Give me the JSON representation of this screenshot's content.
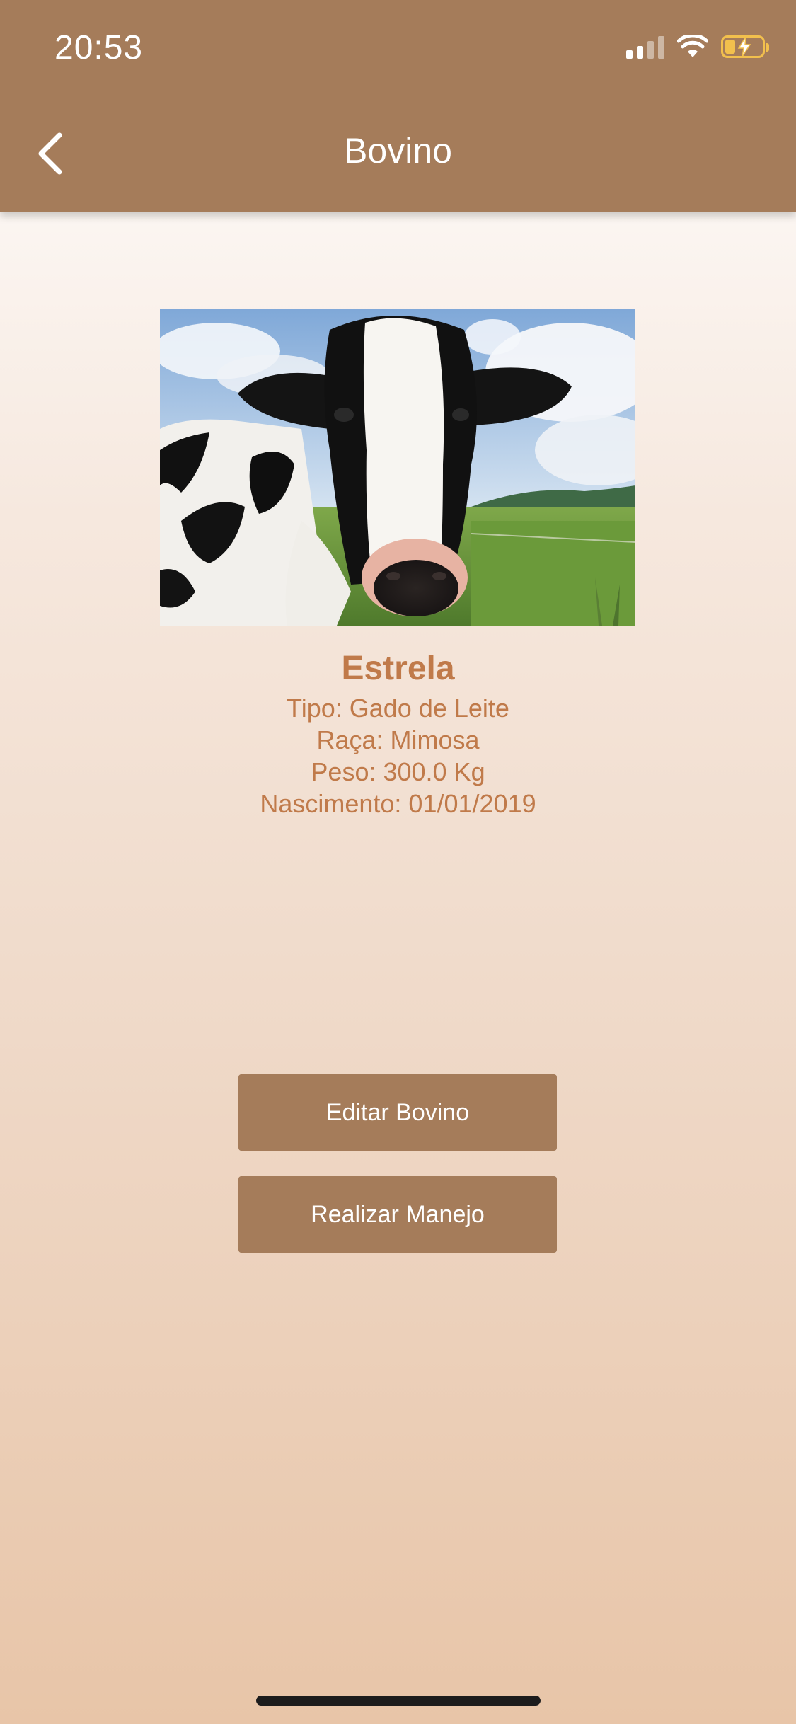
{
  "status_bar": {
    "time": "20:53",
    "signal_icon": "cellular-signal-icon",
    "wifi_icon": "wifi-icon",
    "battery_icon": "battery-charging-icon",
    "battery_color": "#f2c04d"
  },
  "header": {
    "title": "Bovino",
    "back_icon": "chevron-left-icon",
    "background_color": "#a57c5a"
  },
  "animal": {
    "photo_subject": "cow-photo",
    "name": "Estrela",
    "tipo": "Tipo: Gado de Leite",
    "raca": "Raça: Mimosa",
    "peso": "Peso: 300.0 Kg",
    "nascimento": "Nascimento: 01/01/2019",
    "text_color": "#c07a4a"
  },
  "actions": {
    "edit_label": "Editar Bovino",
    "manejo_label": "Realizar Manejo",
    "button_color": "#a57c5a"
  }
}
